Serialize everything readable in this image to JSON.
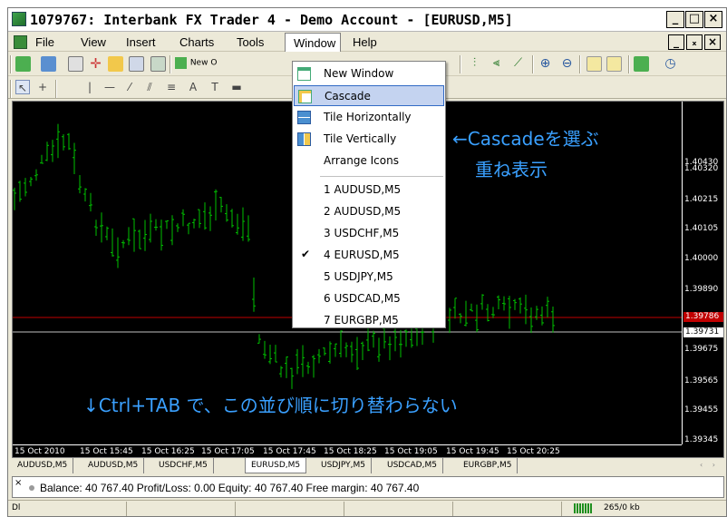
{
  "window": {
    "title": "1079767: Interbank FX Trader 4 - Demo Account - [EURUSD,M5]",
    "caption_buttons": {
      "minimize": "_",
      "maximize": "□",
      "close": "×"
    },
    "mdi_buttons": {
      "minimize": "_",
      "restore": "ₓ",
      "close": "×"
    }
  },
  "menubar": {
    "file": "File",
    "view": "View",
    "insert": "Insert",
    "charts": "Charts",
    "tools": "Tools",
    "window": "Window",
    "help": "Help"
  },
  "toolbar": {
    "new_order": "New O"
  },
  "window_menu": {
    "items": [
      {
        "label": "New Window",
        "icon": "new-window-icon"
      },
      {
        "label": "Cascade",
        "icon": "cascade-icon",
        "highlighted": true
      },
      {
        "label": "Tile Horizontally",
        "icon": "tile-horizontal-icon"
      },
      {
        "label": "Tile Vertically",
        "icon": "tile-vertical-icon"
      },
      {
        "label": "Arrange Icons",
        "icon": ""
      }
    ],
    "windows": [
      {
        "label": "1 AUDUSD,M5",
        "checked": false
      },
      {
        "label": "2 AUDUSD,M5",
        "checked": false
      },
      {
        "label": "3 USDCHF,M5",
        "checked": false
      },
      {
        "label": "4 EURUSD,M5",
        "checked": true
      },
      {
        "label": "5 USDJPY,M5",
        "checked": false
      },
      {
        "label": "6 USDCAD,M5",
        "checked": false
      },
      {
        "label": "7 EURGBP,M5",
        "checked": false
      }
    ],
    "check_mark": "✔"
  },
  "chart": {
    "annotation_cascade": "←Cascadeを選ぶ",
    "annotation_overlap": "重ね表示",
    "annotation_ctrl_tab": "↓Ctrl+TAB で、この並び順に切り替わらない",
    "price_levels": [
      "1.40430",
      "1.40320",
      "1.40215",
      "1.40105",
      "1.40000",
      "1.39890",
      "1.39786",
      "1.39731",
      "1.39675",
      "1.39565",
      "1.39455",
      "1.39345"
    ],
    "ask_label": "1.39786",
    "bid_label": "1.39731",
    "time_labels": [
      "15 Oct 2010",
      "15 Oct 15:45",
      "15 Oct 16:25",
      "15 Oct 17:05",
      "15 Oct 17:45",
      "15 Oct 18:25",
      "15 Oct 19:05",
      "15 Oct 19:45",
      "15 Oct 20:25"
    ],
    "colors": {
      "background": "#000000",
      "bars": "#00c000",
      "ask_line": "#c00000",
      "bid_line": "#c0c0c0",
      "annotation": "#3aa0ff"
    }
  },
  "tabs": [
    "AUDUSD,M5",
    "AUDUSD,M5",
    "USDCHF,M5",
    "EURUSD,M5",
    "USDJPY,M5",
    "USDCAD,M5",
    "EURGBP,M5"
  ],
  "active_tab": "EURUSD,M5",
  "terminal": {
    "close": "×",
    "balance_text": "Balance: 40 767.40  Profit/Loss: 0.00  Equity: 40 767.40  Free margin: 40 767.40"
  },
  "statusbar": {
    "left": "Dl",
    "traffic": "265/0 kb"
  }
}
